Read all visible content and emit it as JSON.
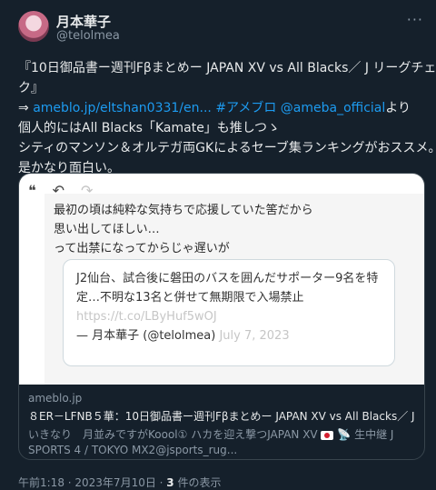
{
  "user": {
    "name": "月本華子",
    "handle": "@telolmea",
    "more_glyph": "···"
  },
  "tweet": {
    "line1": "『10日御品書ー週刊Fβまとめー JAPAN XV vs All Blacks／ J リーグチェッ",
    "line2": "ク』",
    "arrow": "⇒",
    "link": "ameblo.jp/eltshan0331/en...",
    "hashtag": "#アメブロ",
    "mention": "@ameba_official",
    "line3_tail": "より",
    "line4": "個人的にはAll Blacks「Kamate」も推しつゝ",
    "line5": "シティのマンソン＆オルテガ両GKによるセーブ集ランキングがおススメ。",
    "line6": "是かなり面白い。"
  },
  "card": {
    "image": {
      "toolbar": {
        "quote_glyph": "❝",
        "undo_glyph": "↶",
        "redo_glyph": "↷"
      },
      "quote_lines": [
        "最初の頃は純粋な気持ちで応援していた筈だから",
        "思い出してほしい…",
        "って出禁になってからじゃ遅いが"
      ],
      "embed": {
        "line1": "J2仙台、試合後に磐田のバスを囲んだサポーター9名を特",
        "line2": "定…不明な13名と併せて無期限で入場禁止",
        "link": "https://t.co/LByHuf5wOJ",
        "author": "— 月本華子 (@telolmea)",
        "date": "July 7, 2023"
      }
    },
    "domain": "ameblo.jp",
    "title": "８ER－LFNB５華：10日御品書ー週刊Fβまとめー JAPAN XV vs All Blacks／ J リ...",
    "desc1": "いきなり　月並みですがKoool① ハカを迎え撃つJAPAN XV",
    "desc1_tail": "生中継 J",
    "desc2": "SPORTS 4 / TOKYO MX2@jsports_rug..."
  },
  "footer": {
    "time": "午前1:18 · 2023年7月10日 · ",
    "views_count": "3",
    "views_label": " 件の表示"
  }
}
